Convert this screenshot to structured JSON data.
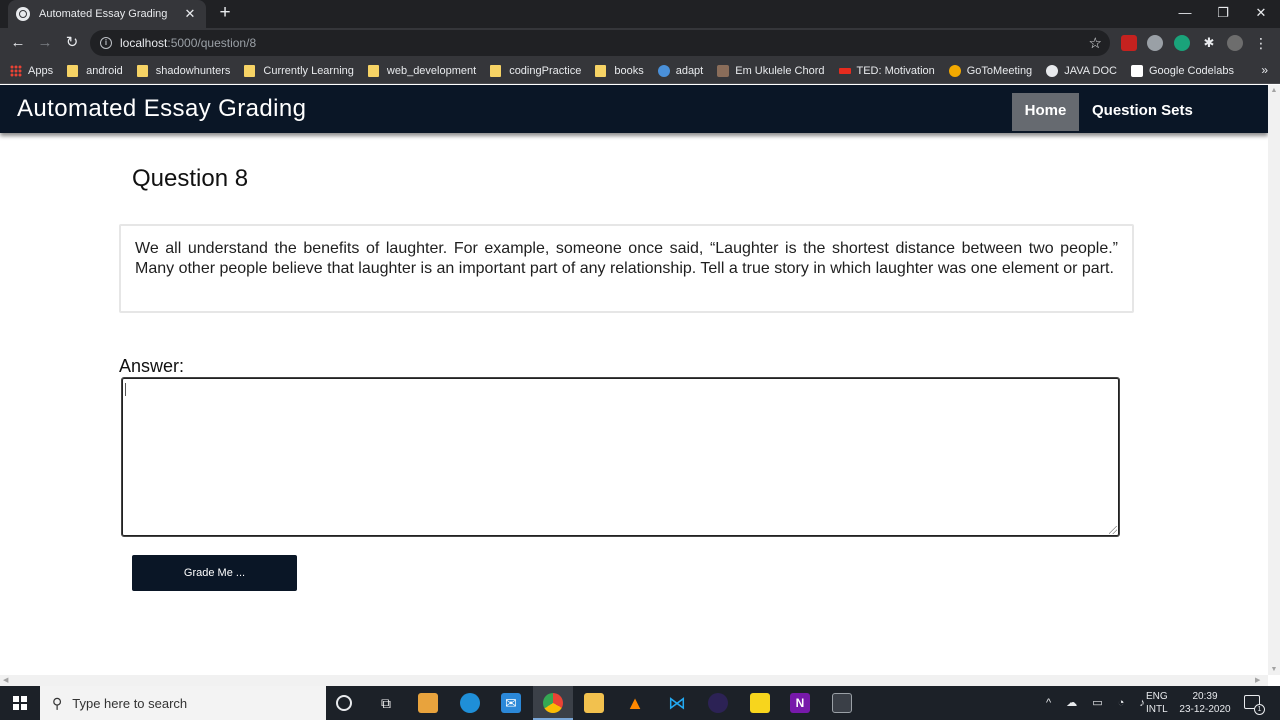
{
  "browser": {
    "tab_title": "Automated Essay Grading",
    "url_host": "localhost",
    "url_path": ":5000/question/8",
    "bookmarks": [
      {
        "label": "Apps",
        "icon": "apps-grid-icon"
      },
      {
        "label": "android",
        "icon": "folder-icon"
      },
      {
        "label": "shadowhunters",
        "icon": "folder-icon"
      },
      {
        "label": "Currently Learning",
        "icon": "folder-icon"
      },
      {
        "label": "web_development",
        "icon": "folder-icon"
      },
      {
        "label": "codingPractice",
        "icon": "folder-icon"
      },
      {
        "label": "books",
        "icon": "folder-icon"
      },
      {
        "label": "adapt",
        "icon": "site-icon"
      },
      {
        "label": "Em Ukulele Chord",
        "icon": "site-icon"
      },
      {
        "label": "TED: Motivation",
        "icon": "ted-icon"
      },
      {
        "label": "GoToMeeting",
        "icon": "gotomeeting-icon"
      },
      {
        "label": "JAVA DOC",
        "icon": "globe-icon"
      },
      {
        "label": "Google Codelabs",
        "icon": "codelabs-icon"
      }
    ]
  },
  "navbar": {
    "brand": "Automated Essay Grading",
    "links": [
      "Home",
      "Question Sets"
    ],
    "active": "Home"
  },
  "question": {
    "title": "Question 8",
    "prompt": "We all understand the benefits of laughter. For example, someone once said, “Laughter is the shortest distance between two people.” Many other people believe that laughter is an important part of any relationship. Tell a true story in which laughter was one element or part."
  },
  "answer": {
    "label": "Answer:",
    "value": "",
    "button_label": "Grade Me ..."
  },
  "taskbar": {
    "search_placeholder": "Type here to search",
    "lang_1": "ENG",
    "lang_2": "INTL",
    "time": "20:39",
    "date": "23-12-2020",
    "notification_count": "1"
  },
  "colors": {
    "navbar_bg": "#0a1626",
    "nav_active_bg": "#666a70",
    "button_bg": "#0a1626"
  }
}
